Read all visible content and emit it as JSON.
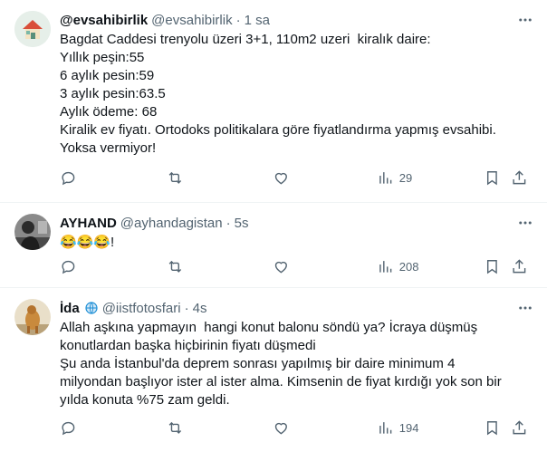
{
  "tweets": [
    {
      "display_name": "@evsahibirlik",
      "handle": "@evsahibirlik",
      "separator": "·",
      "time": "1 sa",
      "lines": [
        "Bagdat Caddesi trenyolu üzeri 3+1, 110m2 uzeri  kiralık daire:",
        "Yıllık peşin:55",
        "6 aylık pesin:59",
        "3 aylık pesin:63.5",
        "Aylık ödeme: 68",
        "Kiralik ev fiyatı. Ortodoks politikalara göre fiyatlandırma yapmış evsahibi.",
        "Yoksa vermiyor!"
      ],
      "views": "29",
      "avatar_icon": "house-logo-icon",
      "avatar_color": "#7ab8a8"
    },
    {
      "display_name": "AYHAND",
      "handle": "@ayhandagistan",
      "separator": "·",
      "time": "5s",
      "lines": [
        "😂😂😂!"
      ],
      "views": "208",
      "avatar_icon": "person-photo-icon",
      "avatar_color": "#3a3a3a"
    },
    {
      "display_name": "İda",
      "handle": "@iistfotosfari",
      "separator": "·",
      "time": "4s",
      "lines": [
        "Allah aşkına yapmayın  hangi konut balonu söndü ya? İcraya düşmüş",
        "konutlardan başka hiçbirinin fiyatı düşmedi",
        "Şu anda İstanbul'da deprem sonrası yapılmış bir daire minimum 4",
        "milyondan başlıyor ister al ister alma. Kimsenin de fiyat kırdığı yok son bir",
        "yılda konuta %75 zam geldi."
      ],
      "views": "194",
      "avatar_icon": "dog-photo-icon",
      "avatar_color": "#c98a3d",
      "name_badge_icon": "globe-icon"
    }
  ],
  "colors": {
    "text": "#0f1419",
    "secondary": "#536471",
    "divider": "#eff3f4"
  }
}
